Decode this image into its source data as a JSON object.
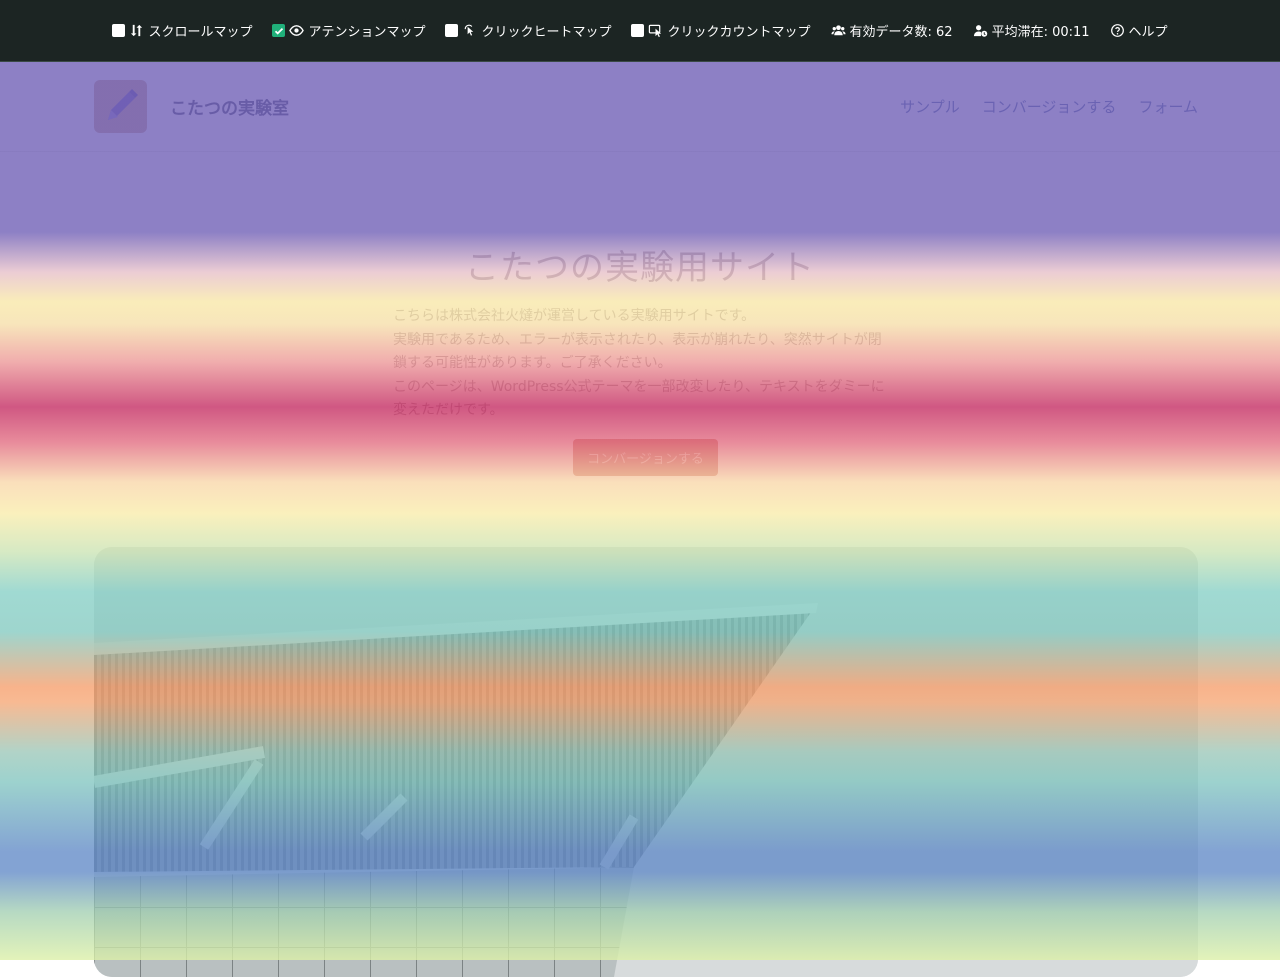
{
  "toolbar": {
    "items": [
      {
        "label": "スクロールマップ",
        "checked": false,
        "icon": "scroll-map-icon"
      },
      {
        "label": "アテンションマップ",
        "checked": true,
        "icon": "eye-icon"
      },
      {
        "label": "クリックヒートマップ",
        "checked": false,
        "icon": "click-heat-icon"
      },
      {
        "label": "クリックカウントマップ",
        "checked": false,
        "icon": "click-count-icon"
      }
    ],
    "data_count_label": "有効データ数: 62",
    "avg_stay_label": "平均滞在: 00:11",
    "help_label": "ヘルプ"
  },
  "site": {
    "title": "こたつの実験室",
    "nav": [
      "サンプル",
      "コンバージョンする",
      "フォーム"
    ]
  },
  "hero": {
    "title": "こたつの実験用サイト",
    "paragraphs": [
      "こちらは株式会社火燵が運営している実験用サイトです。",
      "実験用であるため、エラーが表示されたり、表示が崩れたり、突然サイトが閉鎖する可能性があります。ご了承ください。",
      "このページは、WordPress公式テーマを一部改変したり、テキストをダミーに変えただけです。"
    ],
    "cta_label": "コンバージョンする"
  },
  "colors": {
    "toolbar_bg": "#1c2523",
    "checkbox_on": "#20b07a",
    "heat_hot": "#c83c6e",
    "heat_cold": "#7464b8"
  }
}
